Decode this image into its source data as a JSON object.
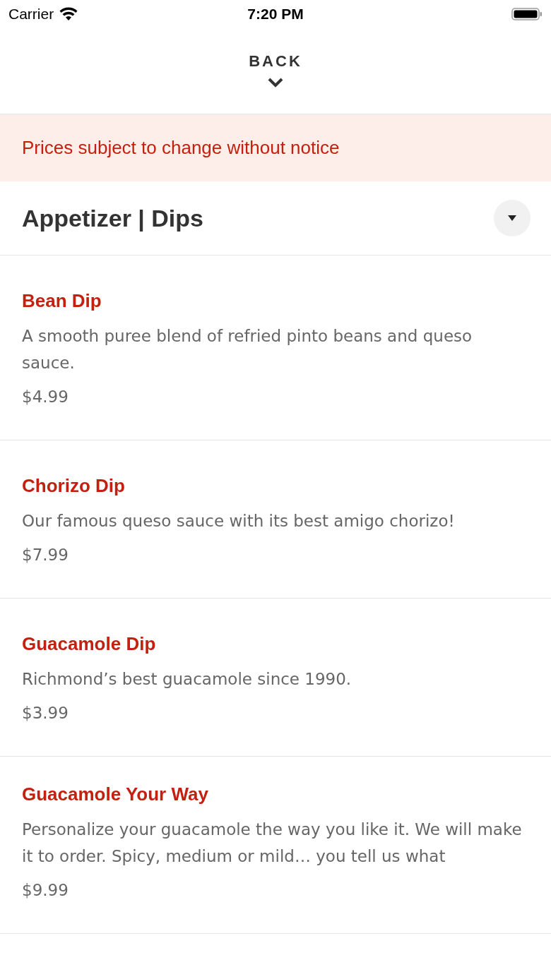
{
  "status_bar": {
    "carrier": "Carrier",
    "time": "7:20 PM"
  },
  "header": {
    "back_label": "BACK"
  },
  "notice": "Prices subject to change without notice",
  "section": {
    "title": "Appetizer | Dips",
    "expanded": false
  },
  "items": [
    {
      "name": "Bean Dip",
      "description": "A smooth puree blend of refried pinto beans and queso sauce.",
      "price": "$4.99"
    },
    {
      "name": "Chorizo Dip",
      "description": "Our famous queso sauce with its best amigo chorizo!",
      "price": "$7.99"
    },
    {
      "name": "Guacamole Dip",
      "description": "Richmond’s best guacamole since 1990.",
      "price": "$3.99"
    },
    {
      "name": "Guacamole Your Way",
      "description": "Personalize your guacamole the way you like it. We will make it to order. Spicy, medium or mild… you tell us what",
      "price": "$9.99"
    }
  ]
}
